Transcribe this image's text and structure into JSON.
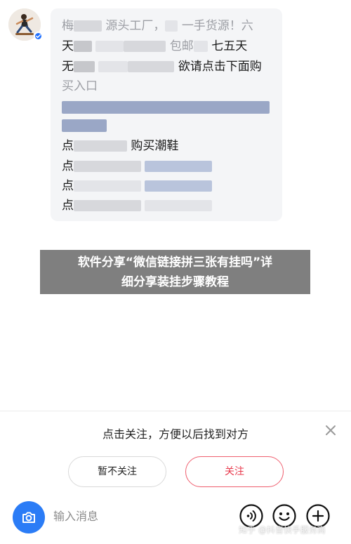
{
  "message": {
    "visible_fragments": {
      "line1_start": "梅",
      "line1_mid": "源头工厂，",
      "line1_mid2": "一手货源！六",
      "line2_start": "天",
      "line2_mid": "包邮",
      "line2_end": "七五天",
      "line3_start": "无",
      "line3_end": "欲请点击下面购",
      "line4": "买入口",
      "line6_start": "点",
      "line6_end": "购买潮鞋",
      "line7_start": "点",
      "line8_start": "点",
      "line9_start": "点"
    }
  },
  "overlay": {
    "line1": "软件分享“微信链接拼三张有挂吗”详",
    "line2": "细分享装挂步骤教程"
  },
  "follow_panel": {
    "prompt": "点击关注，方便以后找到对方",
    "unfollow_label": "暂不关注",
    "follow_label": "关注"
  },
  "input_bar": {
    "placeholder": "输入消息"
  },
  "watermark": "知乎 @抖音快手服务商",
  "colors": {
    "accent_blue": "#2b7cf6",
    "follow_red": "#e8394c",
    "bubble_bg": "#f4f5f7",
    "overlay_bg": "#7f7f7f"
  },
  "icons": [
    "close-icon",
    "camera-icon",
    "voice-icon",
    "emoji-icon",
    "plus-icon",
    "verified-badge-icon"
  ]
}
